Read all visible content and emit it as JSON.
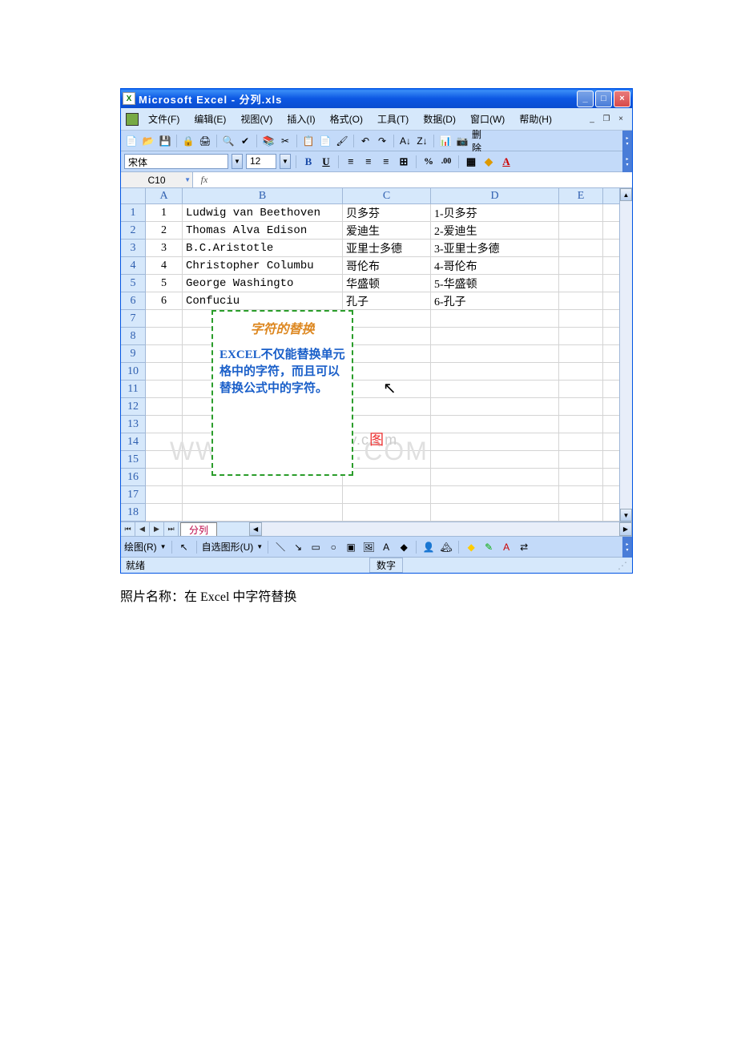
{
  "window": {
    "title": "Microsoft Excel - 分列.xls"
  },
  "menus": {
    "file": "文件(F)",
    "edit": "编辑(E)",
    "view": "视图(V)",
    "insert": "插入(I)",
    "format": "格式(O)",
    "tools": "工具(T)",
    "data": "数据(D)",
    "window": "窗口(W)",
    "help": "帮助(H)"
  },
  "toolbar": {
    "delete_label": "删除"
  },
  "format": {
    "font_name": "宋体",
    "font_size": "12"
  },
  "formula_bar": {
    "name_box": "C10",
    "fx": "fx",
    "value": ""
  },
  "columns": [
    "A",
    "B",
    "C",
    "D",
    "E"
  ],
  "rows": [
    "1",
    "2",
    "3",
    "4",
    "5",
    "6",
    "7",
    "8",
    "9",
    "10",
    "11",
    "12",
    "13",
    "14",
    "15",
    "16",
    "17",
    "18"
  ],
  "cells": {
    "r1": {
      "a": "1",
      "b": "Ludwig van Beethoven",
      "c": "贝多芬",
      "d": "1-贝多芬"
    },
    "r2": {
      "a": "2",
      "b": "Thomas Alva Edison",
      "c": "爱迪生",
      "d": "2-爱迪生"
    },
    "r3": {
      "a": "3",
      "b": "B.C.Aristotle",
      "c": "亚里士多德",
      "d": "3-亚里士多德"
    },
    "r4": {
      "a": "4",
      "b": "Christopher Columbu",
      "c": "哥伦布",
      "d": "4-哥伦布"
    },
    "r5": {
      "a": "5",
      "b": "George Washingto",
      "c": "华盛顿",
      "d": "5-华盛顿"
    },
    "r6": {
      "a": "6",
      "b": "Confuciu",
      "c": "孔子",
      "d": "6-孔子"
    }
  },
  "overlay": {
    "title": "字符的替换",
    "text": "EXCEL不仅能替换单元格中的字符，而且可以替换公式中的字符。"
  },
  "watermarks": {
    "w1_a": "Soft.Yesky.c",
    "w1_b": "图",
    "w1_c": "m",
    "w2": "WWW.DUOCX.COM"
  },
  "sheet_tab": "分列",
  "drawing": {
    "label": "绘图(R)",
    "autoshapes": "自选图形(U)"
  },
  "status": {
    "ready": "就绪",
    "num": "数字"
  },
  "caption": "照片名称：在 Excel 中字符替换"
}
